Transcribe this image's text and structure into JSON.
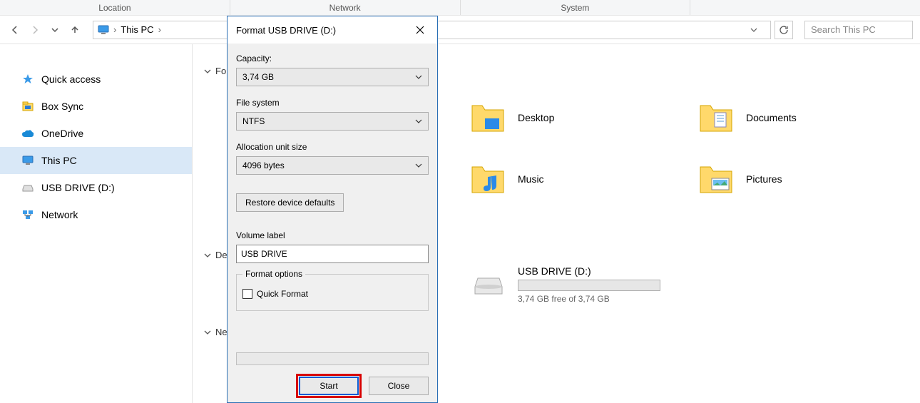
{
  "ribbon": {
    "groups": [
      "Location",
      "Network",
      "System",
      ""
    ]
  },
  "nav": {
    "breadcrumb_item": "This PC",
    "search_placeholder": "Search This PC"
  },
  "sidebar": {
    "items": [
      {
        "label": "Quick access"
      },
      {
        "label": "Box Sync"
      },
      {
        "label": "OneDrive"
      },
      {
        "label": "This PC"
      },
      {
        "label": "USB DRIVE (D:)"
      },
      {
        "label": "Network"
      }
    ]
  },
  "sections": {
    "folders_prefix": "Fo",
    "devices_prefix": "De",
    "network_prefix": "Ne"
  },
  "folders": [
    {
      "label": "Desktop"
    },
    {
      "label": "Documents"
    },
    {
      "label": "Music"
    },
    {
      "label": "Pictures"
    }
  ],
  "drive": {
    "name": "USB DRIVE (D:)",
    "free_text": "3,74 GB free of 3,74 GB"
  },
  "dialog": {
    "title": "Format USB DRIVE (D:)",
    "capacity_label": "Capacity:",
    "capacity_value": "3,74 GB",
    "filesystem_label": "File system",
    "filesystem_value": "NTFS",
    "alloc_label": "Allocation unit size",
    "alloc_value": "4096 bytes",
    "restore_btn": "Restore device defaults",
    "volume_label_lbl": "Volume label",
    "volume_label_value": "USB DRIVE",
    "format_options_legend": "Format options",
    "quick_format_label": "Quick Format",
    "start_btn": "Start",
    "close_btn": "Close"
  }
}
